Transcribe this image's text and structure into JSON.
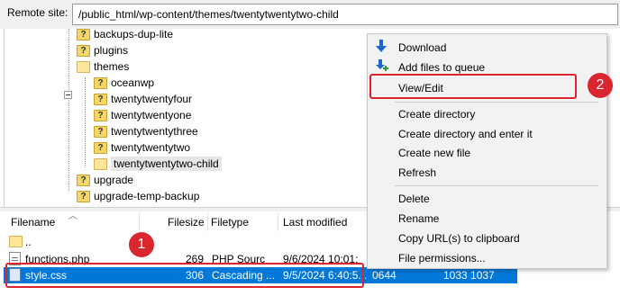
{
  "remote_site": {
    "label": "Remote site:",
    "path": "/public_html/wp-content/themes/twentytwentytwo-child"
  },
  "tree": {
    "items": [
      {
        "label": "backups-dup-lite",
        "icon": "folder-question-icon"
      },
      {
        "label": "plugins",
        "icon": "folder-question-icon"
      },
      {
        "label": "themes",
        "icon": "folder-icon",
        "expanded": true
      },
      {
        "label": "oceanwp",
        "icon": "folder-question-icon"
      },
      {
        "label": "twentytwentyfour",
        "icon": "folder-question-icon"
      },
      {
        "label": "twentytwentyone",
        "icon": "folder-question-icon"
      },
      {
        "label": "twentytwentythree",
        "icon": "folder-question-icon"
      },
      {
        "label": "twentytwentytwo",
        "icon": "folder-question-icon"
      },
      {
        "label": "twentytwentytwo-child",
        "icon": "folder-icon",
        "selected": true
      },
      {
        "label": "upgrade",
        "icon": "folder-question-icon"
      },
      {
        "label": "upgrade-temp-backup",
        "icon": "folder-question-icon"
      }
    ]
  },
  "file_list": {
    "columns": [
      "Filename",
      "Filesize",
      "Filetype",
      "Last modified"
    ],
    "rows": [
      {
        "name": "..",
        "size": "",
        "type": "",
        "modified": "",
        "perms": "",
        "owner": ""
      },
      {
        "name": "functions.php",
        "size": "269",
        "type": "PHP Sourc",
        "modified": "9/6/2024 10:01:",
        "perms": "",
        "owner": ""
      },
      {
        "name": "style.css",
        "size": "306",
        "type": "Cascading ...",
        "modified": "9/5/2024 6:40:5...",
        "perms": "0644",
        "owner": "1033 1037"
      }
    ]
  },
  "context_menu": {
    "items": {
      "download": "Download",
      "add_to_queue": "Add files to queue",
      "view_edit": "View/Edit",
      "create_directory": "Create directory",
      "create_directory_enter": "Create directory and enter it",
      "create_new_file": "Create new file",
      "refresh": "Refresh",
      "delete": "Delete",
      "rename": "Rename",
      "copy_urls": "Copy URL(s) to clipboard",
      "file_permissions": "File permissions..."
    }
  },
  "annotations": {
    "step1": "1",
    "step2": "2",
    "color": "#e0242f"
  },
  "colors": {
    "selection": "#0078d7",
    "menu_bg": "#f2f2f2",
    "icon_blue": "#1a66c9",
    "icon_green": "#2e9a3a"
  }
}
